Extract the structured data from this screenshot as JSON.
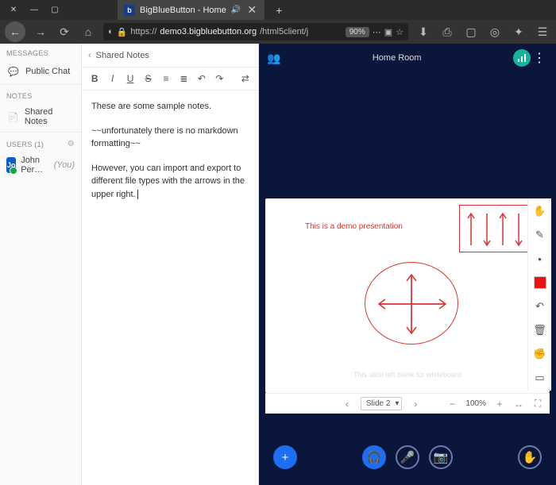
{
  "browser": {
    "tab_title": "BigBlueButton - Home",
    "new_tab": "+",
    "url_prefix": "https://",
    "url_host": "demo3.bigbluebutton.org",
    "url_path": "/html5client/j",
    "zoom": "90%"
  },
  "sidebar": {
    "messages_title": "MESSAGES",
    "public_chat": "Public Chat",
    "notes_title": "NOTES",
    "shared_notes": "Shared Notes",
    "users_title": "USERS (1)",
    "user_initials": "Jo",
    "user_name": "John Per…",
    "user_you": "(You)"
  },
  "notes": {
    "header": "Shared Notes",
    "p1": "These are some sample notes.",
    "p2": "~~unfortunately there is no markdown formatting~~",
    "p3": "However, you can import and export to different file types with the arrows in the upper right."
  },
  "stage": {
    "title": "Home Room",
    "demo_text": "This is a demo presentation",
    "blank_text": "This slide left blank for whiteboard",
    "slide_label": "Slide 2",
    "zoom_pct": "100%"
  }
}
